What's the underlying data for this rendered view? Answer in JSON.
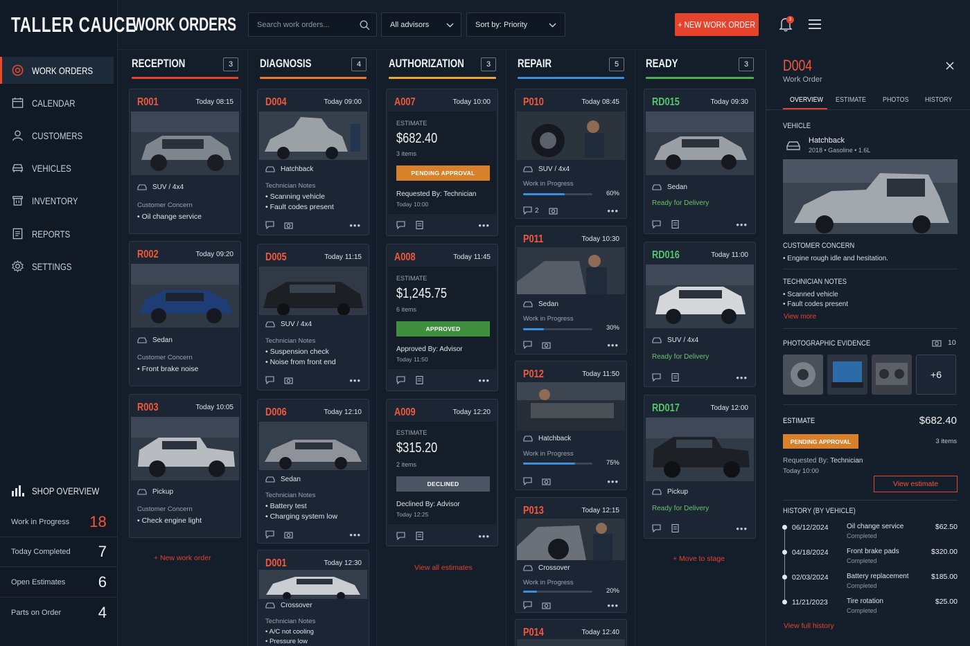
{
  "brand": "TALLER CAUCE",
  "page_title": "WORK ORDERS",
  "nav": [
    {
      "label": "WORK ORDERS",
      "icon": "gear-target-icon",
      "active": true
    },
    {
      "label": "CALENDAR",
      "icon": "calendar-icon"
    },
    {
      "label": "CUSTOMERS",
      "icon": "user-icon"
    },
    {
      "label": "VEHICLES",
      "icon": "car-icon"
    },
    {
      "label": "INVENTORY",
      "icon": "trash-box-icon"
    },
    {
      "label": "REPORTS",
      "icon": "report-icon"
    },
    {
      "label": "SETTINGS",
      "icon": "gear-icon"
    }
  ],
  "shop": {
    "title": "SHOP OVERVIEW",
    "stats": [
      {
        "label": "Work in Progress",
        "value": "18"
      },
      {
        "label": "Today Completed",
        "value": "7"
      },
      {
        "label": "Open Estimates",
        "value": "6"
      },
      {
        "label": "Parts on Order",
        "value": "4"
      }
    ]
  },
  "header": {
    "search_placeholder": "Search work orders...",
    "advisor_filter": "All advisors",
    "sort": "Sort by: Priority",
    "new_button": "+ NEW WORK ORDER",
    "notif_count": "3"
  },
  "colors": {
    "accent": "#e5432b",
    "reception": "#e5432b",
    "diagnosis": "#f07a2a",
    "authorization": "#f0a830",
    "repair": "#3b8fe0",
    "ready": "#4fae4f"
  },
  "columns": {
    "reception": {
      "title": "RECEPTION",
      "count": "3",
      "cards": [
        {
          "id": "R001",
          "time": "Today 08:15",
          "vehicle": "SUV / 4x4",
          "note_title": "Customer Concern",
          "note": "Oil change service"
        },
        {
          "id": "R002",
          "time": "Today 09:20",
          "vehicle": "Sedan",
          "note_title": "Customer Concern",
          "note": "Front brake noise"
        },
        {
          "id": "R003",
          "time": "Today 10:05",
          "vehicle": "Pickup",
          "note_title": "Customer Concern",
          "note": "Check engine light"
        }
      ],
      "footer": "+ New work order"
    },
    "diagnosis": {
      "title": "DIAGNOSIS",
      "count": "4",
      "cards": [
        {
          "id": "D004",
          "time": "Today 09:00",
          "vehicle": "Hatchback",
          "note_title": "Technician Notes",
          "notes": [
            "Scanning vehicle",
            "Fault codes present"
          ]
        },
        {
          "id": "D005",
          "time": "Today 11:15",
          "vehicle": "SUV / 4x4",
          "note_title": "Technician Notes",
          "notes": [
            "Suspension check",
            "Noise from front end"
          ]
        },
        {
          "id": "D006",
          "time": "Today 12:10",
          "vehicle": "Sedan",
          "note_title": "Technician Notes",
          "notes": [
            "Battery test",
            "Charging system low"
          ]
        },
        {
          "id": "D001",
          "time": "Today 12:30",
          "vehicle": "Crossover",
          "note_title": "Technician Notes",
          "notes": [
            "A/C not cooling",
            "Pressure low"
          ]
        }
      ]
    },
    "authorization": {
      "title": "AUTHORIZATION",
      "count": "3",
      "cards": [
        {
          "id": "A007",
          "time": "Today 10:00",
          "label": "ESTIMATE",
          "amount": "$682.40",
          "items": "3 items",
          "status": "PENDING APPROVAL",
          "status_color": "#d9812a",
          "by": "Requested By: Technician",
          "by_time": "Today 10:00"
        },
        {
          "id": "A008",
          "time": "Today 11:45",
          "label": "ESTIMATE",
          "amount": "$1,245.75",
          "items": "6 items",
          "status": "APPROVED",
          "status_color": "#3f8f3f",
          "by": "Approved By: Advisor",
          "by_time": "Today 11:50"
        },
        {
          "id": "A009",
          "time": "Today 12:20",
          "label": "ESTIMATE",
          "amount": "$315.20",
          "items": "2 items",
          "status": "DECLINED",
          "status_color": "#4a5462",
          "by": "Declined By: Advisor",
          "by_time": "Today 12:25"
        }
      ],
      "footer": "View all estimates"
    },
    "repair": {
      "title": "REPAIR",
      "count": "5",
      "cards": [
        {
          "id": "P010",
          "time": "Today 08:45",
          "vehicle": "SUV / 4x4",
          "status": "Work in Progress",
          "progress": 60,
          "pct": "60%",
          "comments": "2"
        },
        {
          "id": "P011",
          "time": "Today 10:30",
          "vehicle": "Sedan",
          "status": "Work in Progress",
          "progress": 30,
          "pct": "30%"
        },
        {
          "id": "P012",
          "time": "Today 11:50",
          "vehicle": "Hatchback",
          "status": "Work in Progress",
          "progress": 75,
          "pct": "75%"
        },
        {
          "id": "P013",
          "time": "Today 12:15",
          "vehicle": "Crossover",
          "status": "Work in Progress",
          "progress": 20,
          "pct": "20%"
        },
        {
          "id": "P014",
          "time": "Today 12:40"
        }
      ]
    },
    "ready": {
      "title": "READY",
      "count": "3",
      "cards": [
        {
          "id": "RD015",
          "time": "Today 09:30",
          "vehicle": "Sedan",
          "status": "Ready for Delivery"
        },
        {
          "id": "RD016",
          "time": "Today 11:00",
          "vehicle": "SUV / 4x4",
          "status": "Ready for Delivery"
        },
        {
          "id": "RD017",
          "time": "Today 12:00",
          "vehicle": "Pickup",
          "status": "Ready for Delivery"
        }
      ],
      "footer": "+ Move to stage"
    }
  },
  "detail": {
    "id": "D004",
    "subtitle": "Work Order",
    "tabs": [
      "OVERVIEW",
      "ESTIMATE",
      "PHOTOS",
      "HISTORY"
    ],
    "vehicle_title": "VEHICLE",
    "vehicle_name": "Hatchback",
    "vehicle_meta": "2018 • Gasoline • 1.6L",
    "concern_title": "CUSTOMER CONCERN",
    "concern": "Engine rough idle and hesitation.",
    "tech_title": "TECHNICIAN NOTES",
    "tech_notes": [
      "Scanned vehicle",
      "Fault codes present"
    ],
    "view_more": "View more",
    "evidence_title": "PHOTOGRAPHIC EVIDENCE",
    "evidence_count": "10",
    "evidence_more": "+6",
    "estimate_title": "ESTIMATE",
    "estimate_amount": "$682.40",
    "estimate_status": "PENDING APPROVAL",
    "estimate_items": "3 items",
    "requested_by_label": "Requested By:",
    "requested_by": "Technician",
    "requested_time": "Today 10:00",
    "view_estimate": "View estimate",
    "history_title": "HISTORY (BY VEHICLE)",
    "history": [
      {
        "date": "06/12/2024",
        "service": "Oil change service",
        "status": "Completed",
        "amount": "$62.50"
      },
      {
        "date": "04/18/2024",
        "service": "Front brake pads",
        "status": "Completed",
        "amount": "$320.00"
      },
      {
        "date": "02/03/2024",
        "service": "Battery replacement",
        "status": "Completed",
        "amount": "$185.00"
      },
      {
        "date": "11/21/2023",
        "service": "Tire rotation",
        "status": "Completed",
        "amount": "$25.00"
      }
    ],
    "view_history": "View full history"
  }
}
